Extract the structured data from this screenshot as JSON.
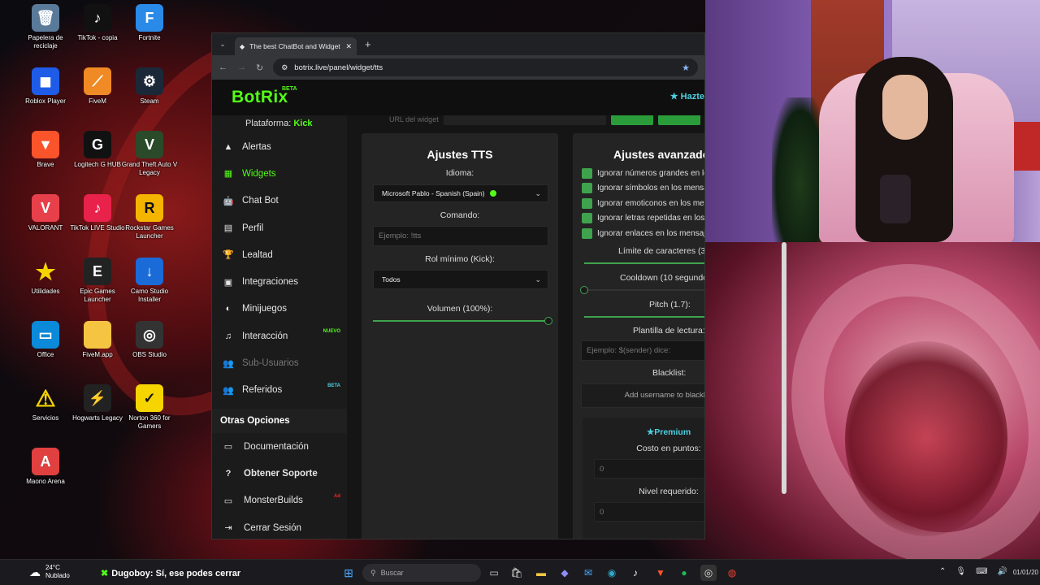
{
  "desktop_icons": [
    {
      "label": "Papelera de reciclaje",
      "icon": "recycle-bin-icon"
    },
    {
      "label": "TikTok - copia",
      "icon": "tiktok-icon"
    },
    {
      "label": "Fortnite",
      "icon": "fortnite-icon"
    },
    {
      "label": "Roblox Player",
      "icon": "roblox-icon"
    },
    {
      "label": "FiveM",
      "icon": "fivem-icon"
    },
    {
      "label": "Steam",
      "icon": "steam-icon"
    },
    {
      "label": "Brave",
      "icon": "brave-icon"
    },
    {
      "label": "Logitech G HUB",
      "icon": "logitech-icon"
    },
    {
      "label": "Grand Theft Auto V Legacy",
      "icon": "gta-icon"
    },
    {
      "label": "VALORANT",
      "icon": "valorant-icon"
    },
    {
      "label": "TikTok LIVE Studio",
      "icon": "tiktok-live-icon"
    },
    {
      "label": "Rockstar Games Launcher",
      "icon": "rockstar-icon"
    },
    {
      "label": "Utilidades",
      "icon": "star-folder-icon"
    },
    {
      "label": "Epic Games Launcher",
      "icon": "epic-icon"
    },
    {
      "label": "Camo Studio Installer",
      "icon": "installer-icon"
    },
    {
      "label": "Office",
      "icon": "office-icon"
    },
    {
      "label": "FiveM.app",
      "icon": "folder-icon"
    },
    {
      "label": "OBS Studio",
      "icon": "obs-icon"
    },
    {
      "label": "Servicios",
      "icon": "warning-icon"
    },
    {
      "label": "Hogwarts Legacy",
      "icon": "hogwarts-icon"
    },
    {
      "label": "Norton 360 for Gamers",
      "icon": "norton-icon"
    },
    {
      "label": "Maono Arena",
      "icon": "maono-icon"
    }
  ],
  "browser": {
    "tab_title": "The best ChatBot and Widgets",
    "url": "botrix.live/panel/widget/tts"
  },
  "app": {
    "logo": "BotRix",
    "logo_badge": "BETA",
    "cta": "Hazte",
    "platform_label": "Plataforma:",
    "platform_value": "Kick",
    "url_row_label": "URL del widget"
  },
  "sidebar": {
    "items": [
      {
        "label": "Alertas",
        "icon": "warning-icon"
      },
      {
        "label": "Widgets",
        "icon": "widgets-icon",
        "active": true
      },
      {
        "label": "Chat Bot",
        "icon": "robot-icon"
      },
      {
        "label": "Perfil",
        "icon": "id-card-icon"
      },
      {
        "label": "Lealtad",
        "icon": "trophy-icon"
      },
      {
        "label": "Integraciones",
        "icon": "plug-icon"
      },
      {
        "label": "Minijuegos",
        "icon": "gamepad-icon"
      },
      {
        "label": "Interacción",
        "icon": "music-icon",
        "badge": "NUEVO"
      },
      {
        "label": "Sub-Usuarios",
        "icon": "users-icon",
        "dim": true
      },
      {
        "label": "Referidos",
        "icon": "referral-icon",
        "badge": "BETA"
      }
    ],
    "section_title": "Otras Opciones",
    "other": [
      {
        "label": "Documentación",
        "icon": "doc-icon"
      },
      {
        "label": "Obtener Soporte",
        "icon": "help-icon",
        "bold": true
      },
      {
        "label": "MonsterBuilds",
        "icon": "monitor-icon",
        "badge": "Ad"
      },
      {
        "label": "Cerrar Sesión",
        "icon": "logout-icon"
      }
    ]
  },
  "tts": {
    "title": "Ajustes TTS",
    "language_label": "Idioma:",
    "language_value": "Microsoft Pablo - Spanish (Spain)",
    "command_label": "Comando:",
    "command_placeholder": "Ejemplo: !tts",
    "role_label": "Rol mínimo (Kick):",
    "role_value": "Todos",
    "volume_label": "Volumen (100%):",
    "volume_pct": 100
  },
  "advanced": {
    "title": "Ajustes avanzados",
    "checks": [
      "Ignorar números grandes en los mensajes",
      "Ignorar símbolos en los mensajes",
      "Ignorar emoticonos en los mensajes",
      "Ignorar letras repetidas en los mensajes",
      "Ignorar enlaces en los mensajes"
    ],
    "char_limit_label": "Límite de caracteres (300):",
    "char_limit_pct": 100,
    "cooldown_label": "Cooldown (10 segundos):",
    "cooldown_pct": 0,
    "pitch_label": "Pitch (1.7):",
    "pitch_pct": 85,
    "template_label": "Plantilla de lectura:",
    "template_placeholder": "Ejemplo: $(sender) dice:",
    "blacklist_label": "Blacklist:",
    "blacklist_button": "Add username to blacklist",
    "premium_title": "Premium",
    "cost_label": "Costo en puntos:",
    "cost_value": "0",
    "level_label": "Nivel requerido:",
    "level_value": "0"
  },
  "taskbar": {
    "temp": "24°C",
    "weather": "Nublado",
    "chat_user": "Dugoboy",
    "chat_text": ": Sí, ese podes cerrar",
    "search_placeholder": "Buscar",
    "date": "01/01/20"
  },
  "colors": {
    "accent": "#53fc18",
    "slider": "#3fa34d",
    "cyan": "#4dd0e1"
  }
}
